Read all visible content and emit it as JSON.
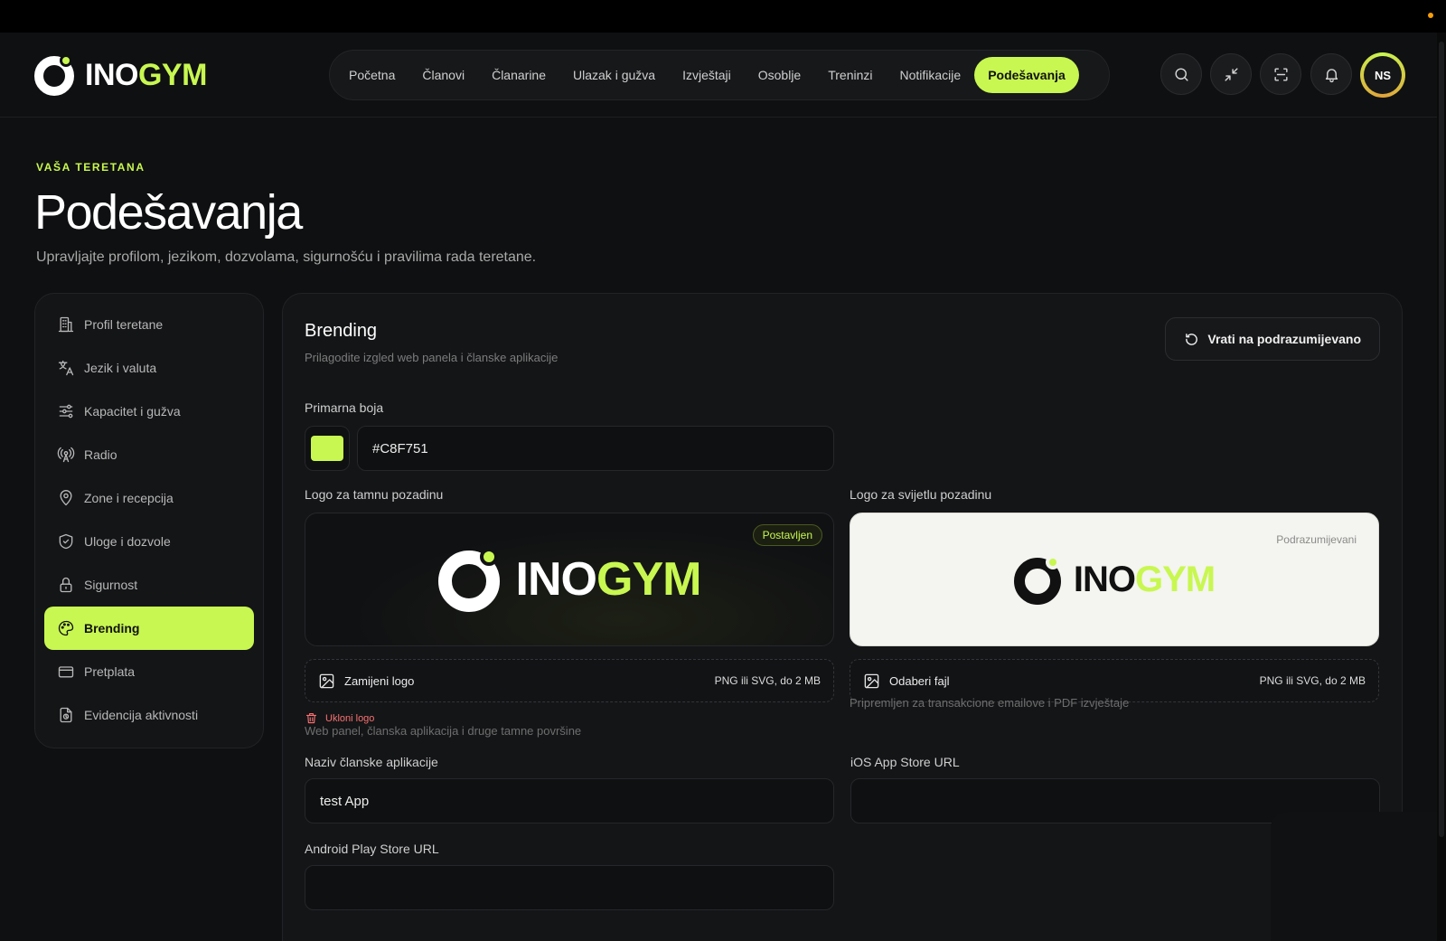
{
  "brand": {
    "logo_part1": "INO",
    "logo_part2": "GYM",
    "accent": "#C8F751"
  },
  "nav": {
    "items": [
      {
        "label": "Početna"
      },
      {
        "label": "Članovi"
      },
      {
        "label": "Članarine"
      },
      {
        "label": "Ulazak i gužva"
      },
      {
        "label": "Izvještaji"
      },
      {
        "label": "Osoblje"
      },
      {
        "label": "Treninzi"
      },
      {
        "label": "Notifikacije"
      },
      {
        "label": "Podešavanja",
        "active": true
      }
    ]
  },
  "header_icons": [
    "search-icon",
    "minimize-icon",
    "scan-icon",
    "bell-icon"
  ],
  "user": {
    "initials": "NS"
  },
  "page": {
    "eyebrow": "VAŠA TERETANA",
    "title": "Podešavanja",
    "subtitle": "Upravljajte profilom, jezikom, dozvolama, sigurnošću i pravilima rada teretane."
  },
  "sidebar": {
    "items": [
      {
        "label": "Profil teretane",
        "icon": "building-icon"
      },
      {
        "label": "Jezik i valuta",
        "icon": "translate-icon"
      },
      {
        "label": "Kapacitet i gužva",
        "icon": "sliders-icon"
      },
      {
        "label": "Radio",
        "icon": "radio-icon"
      },
      {
        "label": "Zone i recepcija",
        "icon": "map-pin-icon"
      },
      {
        "label": "Uloge i dozvole",
        "icon": "shield-icon"
      },
      {
        "label": "Sigurnost",
        "icon": "lock-icon"
      },
      {
        "label": "Brending",
        "icon": "palette-icon",
        "active": true
      },
      {
        "label": "Pretplata",
        "icon": "credit-card-icon"
      },
      {
        "label": "Evidencija aktivnosti",
        "icon": "activity-log-icon"
      }
    ]
  },
  "panel": {
    "title": "Brending",
    "subtitle": "Prilagodite izgled web panela i članske aplikacije",
    "reset_label": "Vrati na podrazumijevano",
    "primary_color_label": "Primarna boja",
    "primary_color_value": "#C8F751",
    "logo_dark": {
      "label": "Logo za tamnu pozadinu",
      "badge": "Postavljen",
      "upload_label": "Zamijeni logo",
      "spec": "PNG ili SVG, do 2 MB",
      "remove_label": "Ukloni logo",
      "hint": "Web panel, članska aplikacija i druge tamne površine"
    },
    "logo_light": {
      "label": "Logo za svijetlu pozadinu",
      "badge": "Podrazumijevani",
      "upload_label": "Odaberi fajl",
      "spec": "PNG ili SVG, do 2 MB",
      "hint": "Pripremljen za transakcione emailove i PDF izvještaje"
    },
    "app_name_label": "Naziv članske aplikacije",
    "app_name_value": "test App",
    "ios_label": "iOS App Store URL",
    "ios_value": "",
    "android_label": "Android Play Store URL",
    "android_value": ""
  }
}
